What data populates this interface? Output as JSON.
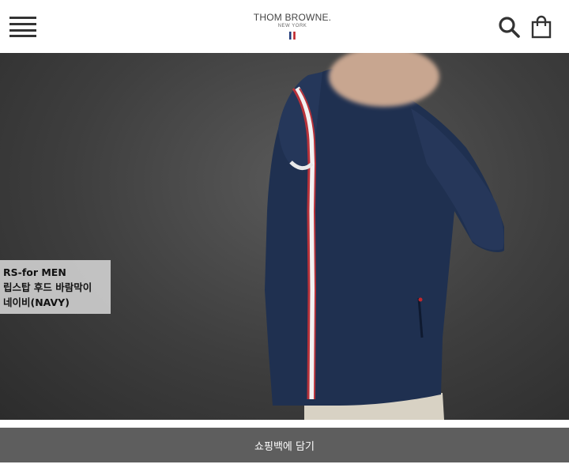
{
  "header": {
    "menu_icon": "hamburger-menu-icon",
    "logo": {
      "brand": "THOM BROWNE.",
      "sub": "NEW YORK",
      "flag_colors": [
        "#1f3a7a",
        "#ffffff",
        "#c0272d"
      ]
    },
    "search_icon": "search-icon",
    "bag_icon": "shopping-bag-icon"
  },
  "product": {
    "caption_lines": [
      "RS-for MEN",
      "립스탑 후드 바람막이",
      "네이비(NAVY)"
    ],
    "jacket_color": "#1e2f4e"
  },
  "cta": {
    "label": "쇼핑백에 담기"
  }
}
